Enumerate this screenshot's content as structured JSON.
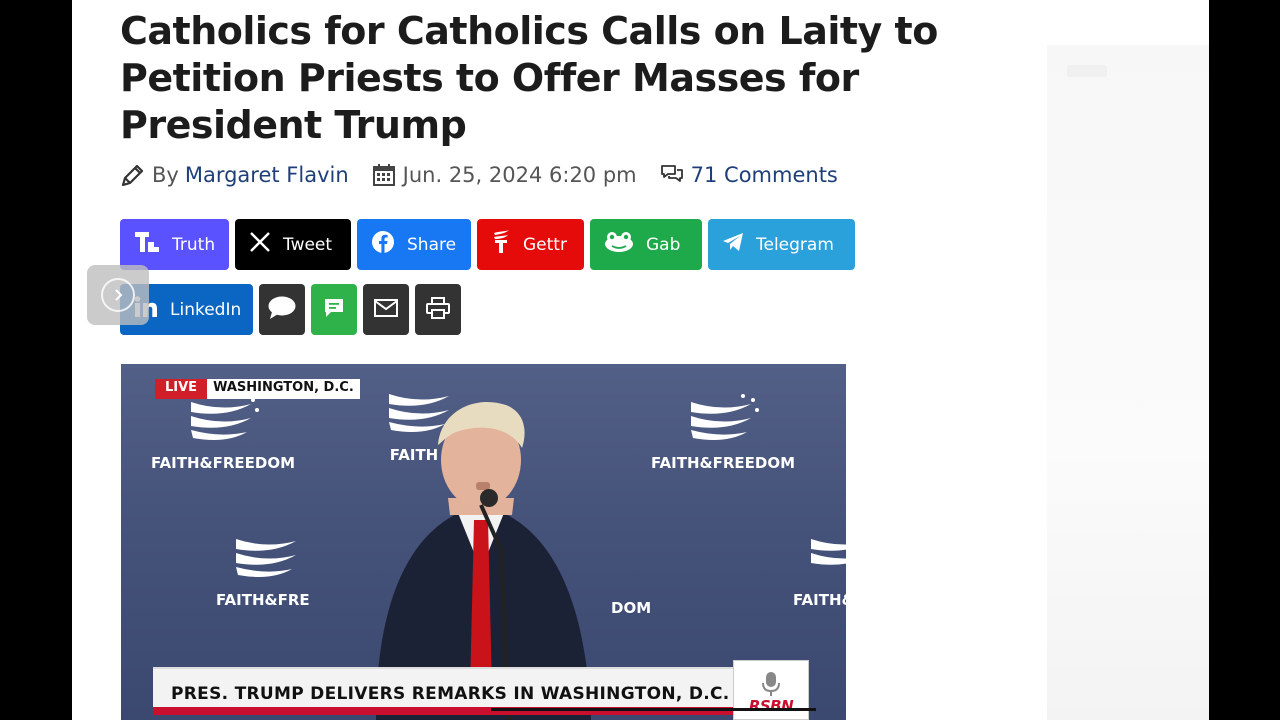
{
  "article": {
    "title": "Catholics for Catholics Calls on Laity to Petition Priests to Offer Masses for President Trump",
    "by_label": "By",
    "author": "Margaret Flavin",
    "date": "Jun. 25, 2024 6:20 pm",
    "comments": "71 Comments"
  },
  "share_buttons": {
    "truth": "Truth",
    "tweet": "Tweet",
    "facebook": "Share",
    "gettr": "Gettr",
    "gab": "Gab",
    "telegram": "Telegram",
    "linkedin": "LinkedIn"
  },
  "video": {
    "live_label": "LIVE",
    "location": "WASHINGTON, D.C.",
    "backdrop_logo": "FAITH&FREEDOM",
    "backdrop_logo_partial": "FAITH&FRE",
    "backdrop_logo_right": "FAITH&",
    "backdrop_logo_small": "FAITH",
    "backdrop_logo_tail": "DOM",
    "lower_third": "PRES. TRUMP DELIVERS REMARKS IN WASHINGTON, D.C.",
    "channel": "RSBN"
  },
  "colors": {
    "truth": "#5a52ff",
    "tweet": "#000000",
    "facebook": "#1877f2",
    "gettr": "#e50b0b",
    "gab": "#1ea94a",
    "telegram": "#2aa1da",
    "linkedin": "#0a66c2",
    "link": "#1f3f7a"
  }
}
